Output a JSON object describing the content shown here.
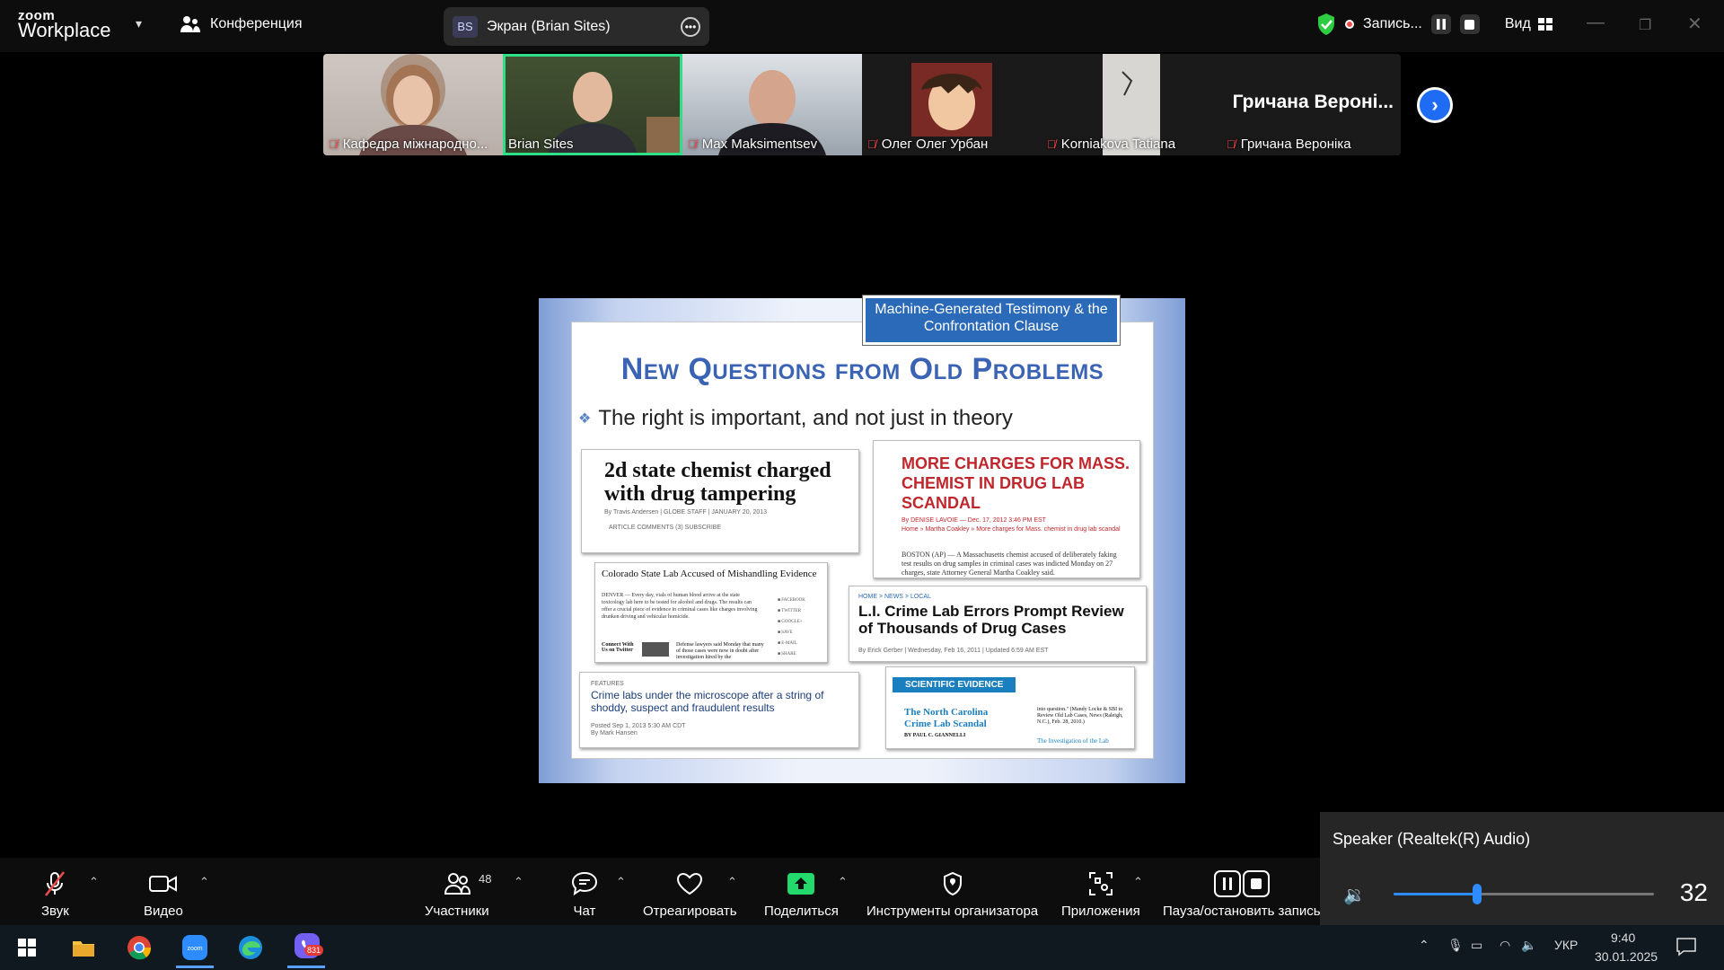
{
  "app": {
    "logo_top": "zoom",
    "logo_bottom": "Workplace",
    "meeting_label": "Конференция"
  },
  "screen_share": {
    "initials": "BS",
    "label": "Экран (Brian Sites)"
  },
  "recording": {
    "label": "Запись..."
  },
  "view": {
    "label": "Вид"
  },
  "participants_strip": [
    {
      "name": "Кафедра міжнародно..."
    },
    {
      "name": "Brian Sites"
    },
    {
      "name": "Max Maksimentsev"
    },
    {
      "name": "Олег Олег Урбан"
    },
    {
      "name": "Korniakova Tatiana"
    },
    {
      "name": "Гричана Вероніка",
      "big_name": "Гричана Вероні..."
    }
  ],
  "slide": {
    "tag": "Machine-Generated Testimony & the Confrontation Clause",
    "title": "New Questions from Old Problems",
    "bullet": "The right is important, and not just in theory",
    "clips": {
      "c1_head": "2d state chemist charged with drug tampering",
      "c1_byline": "By Travis Andersen  |  GLOBE STAFF  |  JANUARY 20, 2013",
      "c1_meta": "ARTICLE   COMMENTS (3)   SUBSCRIBE",
      "c2_head": "MORE CHARGES FOR MASS. CHEMIST IN DRUG LAB SCANDAL",
      "c2_byline": "By DENISE LAVOIE — Dec. 17, 2012 3:46 PM EST",
      "c2_crumb": "Home » Martha Coakley » More charges for Mass. chemist in drug lab scandal",
      "c2_body": "BOSTON (AP) — A Massachusetts chemist accused of deliberately faking test results on drug samples in criminal cases was indicted Monday on 27 charges, state Attorney General Martha Coakley said.",
      "c3_head": "Colorado State Lab Accused of Mishandling Evidence",
      "c3_body": "DENVER — Every day, vials of human blood arrive at the state toxicology lab here to be tested for alcohol and drugs. The results can offer a crucial piece of evidence in criminal cases like charges involving drunken driving and vehicular homicide.",
      "c3_connect": "Connect With Us on Twitter",
      "c3_more": "Defense lawyers said Monday that many of those cases were now in doubt after investigation hired by the",
      "c4_crumb": "HOME > NEWS > LOCAL",
      "c4_head": "L.I. Crime Lab Errors Prompt Review of Thousands of Drug Cases",
      "c4_byline": "By Erick Gerber | Wednesday, Feb 16, 2011 | Updated 6:59 AM EST",
      "c5_label": "FEATURES",
      "c5_head": "Crime labs under the microscope after a string of shoddy, suspect and fraudulent results",
      "c5_posted": "Posted Sep 1, 2013 5:30 AM CDT",
      "c5_by": "By Mark Hansen",
      "c6_badge": "SCIENTIFIC EVIDENCE",
      "c6_head": "The North Carolina Crime Lab Scandal",
      "c6_by": "BY PAUL C. GIANNELLI",
      "c6_side": "into question.\" (Mandy Locke & SBI to Review Old Lab Cases, News (Raleigh, N.C.), Feb. 28, 2010.)",
      "c6_link": "The Investigation of the Lab"
    }
  },
  "toolbar": {
    "audio": "Звук",
    "video": "Видео",
    "participants": "Участники",
    "participants_count": "48",
    "chat": "Чат",
    "react": "Отреагировать",
    "share": "Поделиться",
    "host_tools": "Инструменты организатора",
    "apps": "Приложения",
    "pause_stop": "Пауза/остановить запись"
  },
  "speaker_popup": {
    "title": "Speaker (Realtek(R) Audio)",
    "volume": 32,
    "volume_fraction": 0.32
  },
  "taskbar": {
    "lang": "УКР",
    "time": "9:40",
    "date": "30.01.2025",
    "badge": "831"
  },
  "colors": {
    "accent": "#2d8cff",
    "active_speaker": "#2fdf86",
    "record": "#f24b4b",
    "share_green": "#23d96b"
  }
}
